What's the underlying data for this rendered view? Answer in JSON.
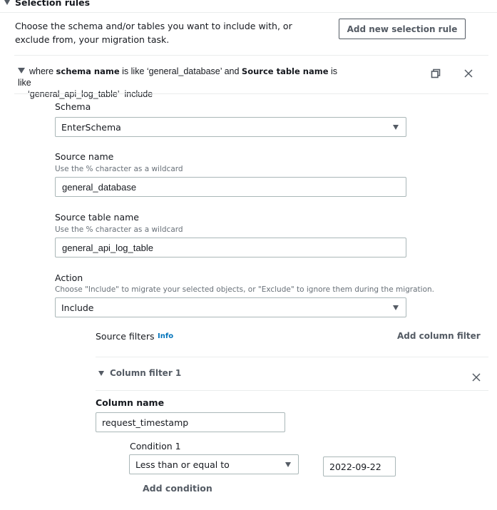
{
  "section": {
    "title": "Selection rules",
    "description": "Choose the schema and/or tables you want to include with, or exclude from, your migration task.",
    "add_rule_label": "Add new selection rule"
  },
  "rule": {
    "summary": {
      "prefix": "where",
      "schema_key": "schema name",
      "schema_op": "is like",
      "schema_value": "‘general_database’",
      "conj": "and",
      "table_key": "Source table name",
      "table_op": "is like",
      "table_value": "‘general_api_log_table’",
      "action": "include"
    },
    "icons": {
      "copy": "copy-icon",
      "close": "close-icon"
    },
    "schema": {
      "label": "Schema",
      "value": "EnterSchema"
    },
    "source_name": {
      "label": "Source name",
      "hint": "Use the % character as a wildcard",
      "value": "general_database"
    },
    "source_table_name": {
      "label": "Source table name",
      "hint": "Use the % character as a wildcard",
      "value": "general_api_log_table"
    },
    "action": {
      "label": "Action",
      "hint": "Choose \"Include\" to migrate your selected objects, or \"Exclude\" to ignore them during the migration.",
      "value": "Include"
    },
    "source_filters": {
      "label": "Source filters",
      "info_label": "Info",
      "add_column_filter_label": "Add column filter",
      "column_filters": [
        {
          "title": "Column filter 1",
          "column_name_label": "Column name",
          "column_name_value": "request_timestamp",
          "conditions": [
            {
              "label": "Condition 1",
              "operator": "Less than or equal to",
              "value": "2022-09-22"
            }
          ],
          "add_condition_label": "Add condition"
        }
      ]
    }
  },
  "colors": {
    "link": "#0073bb",
    "text": "#16191f",
    "muted": "#545b64",
    "hint": "#687078",
    "border": "#aab7b8",
    "divider": "#eaeded"
  }
}
